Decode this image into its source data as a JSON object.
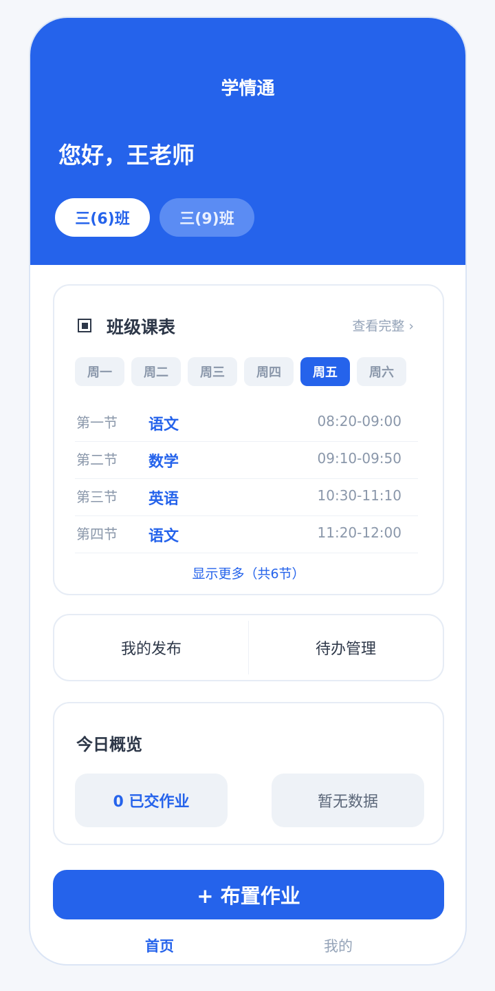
{
  "app": {
    "title": "学情通"
  },
  "greeting": "您好，王老师",
  "class_tabs": [
    {
      "label": "三(6)班",
      "active": true
    },
    {
      "label": "三(9)班",
      "active": false
    }
  ],
  "schedule": {
    "title": "班级课表",
    "view_all": "查看完整 ›",
    "days": [
      "周一",
      "周二",
      "周三",
      "周四",
      "周五",
      "周六"
    ],
    "active_day": "周五",
    "periods": [
      {
        "name": "第一节",
        "subject": "语文",
        "time": "08:20-09:00"
      },
      {
        "name": "第二节",
        "subject": "数学",
        "time": "09:10-09:50"
      },
      {
        "name": "第三节",
        "subject": "英语",
        "time": "10:30-11:10"
      },
      {
        "name": "第四节",
        "subject": "语文",
        "time": "11:20-12:00"
      }
    ],
    "show_more": "显示更多（共6节）"
  },
  "actions": {
    "my_posts": "我的发布",
    "todo": "待办管理"
  },
  "overview": {
    "title": "今日概览",
    "submitted": "0 已交作业",
    "no_data": "暂无数据"
  },
  "assign_button": "+ 布置作业",
  "nav": {
    "home": "首页",
    "mine": "我的"
  },
  "colors": {
    "primary": "#2563eb",
    "background": "#f5f7fb"
  }
}
